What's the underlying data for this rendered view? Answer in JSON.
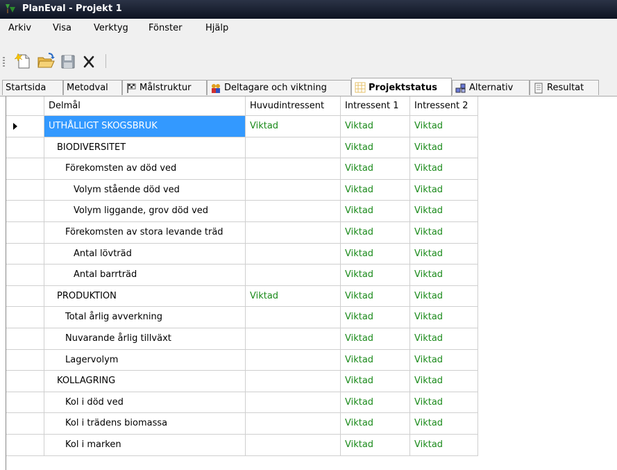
{
  "window": {
    "title": "PlanEval - Projekt 1"
  },
  "menu": [
    {
      "label": "Arkiv"
    },
    {
      "label": "Visa"
    },
    {
      "label": "Verktyg"
    },
    {
      "label": "Fönster"
    },
    {
      "label": "Hjälp"
    }
  ],
  "toolbar": {
    "buttons": [
      {
        "icon": "new-file-icon"
      },
      {
        "icon": "open-folder-icon"
      },
      {
        "icon": "save-icon"
      },
      {
        "icon": "delete-icon"
      }
    ]
  },
  "tabs": [
    {
      "label": "Startsida",
      "icon": ""
    },
    {
      "label": "Metodval",
      "icon": ""
    },
    {
      "label": "Målstruktur",
      "icon": "flag-icon"
    },
    {
      "label": "Deltagare och viktning",
      "icon": "people-icon"
    },
    {
      "label": "Projektstatus",
      "icon": "grid-icon",
      "active": true
    },
    {
      "label": "Alternativ",
      "icon": "cubes-icon"
    },
    {
      "label": "Resultat",
      "icon": "document-icon"
    }
  ],
  "grid": {
    "columns": [
      "Delmål",
      "Huvudintressent",
      "Intressent 1",
      "Intressent 2"
    ],
    "rows": [
      {
        "name": "UTHÅLLIGT SKOGSBRUK",
        "level": 0,
        "selected": true,
        "c1": "Viktad",
        "c2": "Viktad",
        "c3": "Viktad"
      },
      {
        "name": "BIODIVERSITET",
        "level": 1,
        "c1": "",
        "c2": "Viktad",
        "c3": "Viktad"
      },
      {
        "name": "Förekomsten av död ved",
        "level": 2,
        "c1": "",
        "c2": "Viktad",
        "c3": "Viktad"
      },
      {
        "name": "Volym stående död ved",
        "level": 3,
        "c1": "",
        "c2": "Viktad",
        "c3": "Viktad"
      },
      {
        "name": "Volym liggande, grov död ved",
        "level": 3,
        "c1": "",
        "c2": "Viktad",
        "c3": "Viktad"
      },
      {
        "name": "Förekomsten av stora levande träd",
        "level": 2,
        "c1": "",
        "c2": "Viktad",
        "c3": "Viktad"
      },
      {
        "name": "Antal lövträd",
        "level": 3,
        "c1": "",
        "c2": "Viktad",
        "c3": "Viktad"
      },
      {
        "name": "Antal barrträd",
        "level": 3,
        "c1": "",
        "c2": "Viktad",
        "c3": "Viktad"
      },
      {
        "name": "PRODUKTION",
        "level": 1,
        "c1": "Viktad",
        "c2": "Viktad",
        "c3": "Viktad"
      },
      {
        "name": "Total årlig avverkning",
        "level": 2,
        "c1": "",
        "c2": "Viktad",
        "c3": "Viktad"
      },
      {
        "name": "Nuvarande årlig tillväxt",
        "level": 2,
        "c1": "",
        "c2": "Viktad",
        "c3": "Viktad"
      },
      {
        "name": "Lagervolym",
        "level": 2,
        "c1": "",
        "c2": "Viktad",
        "c3": "Viktad"
      },
      {
        "name": "KOLLAGRING",
        "level": 1,
        "c1": "",
        "c2": "Viktad",
        "c3": "Viktad"
      },
      {
        "name": "Kol i död ved",
        "level": 2,
        "c1": "",
        "c2": "Viktad",
        "c3": "Viktad"
      },
      {
        "name": "Kol i trädens biomassa",
        "level": 2,
        "c1": "",
        "c2": "Viktad",
        "c3": "Viktad"
      },
      {
        "name": "Kol i marken",
        "level": 2,
        "c1": "",
        "c2": "Viktad",
        "c3": "Viktad"
      }
    ]
  }
}
